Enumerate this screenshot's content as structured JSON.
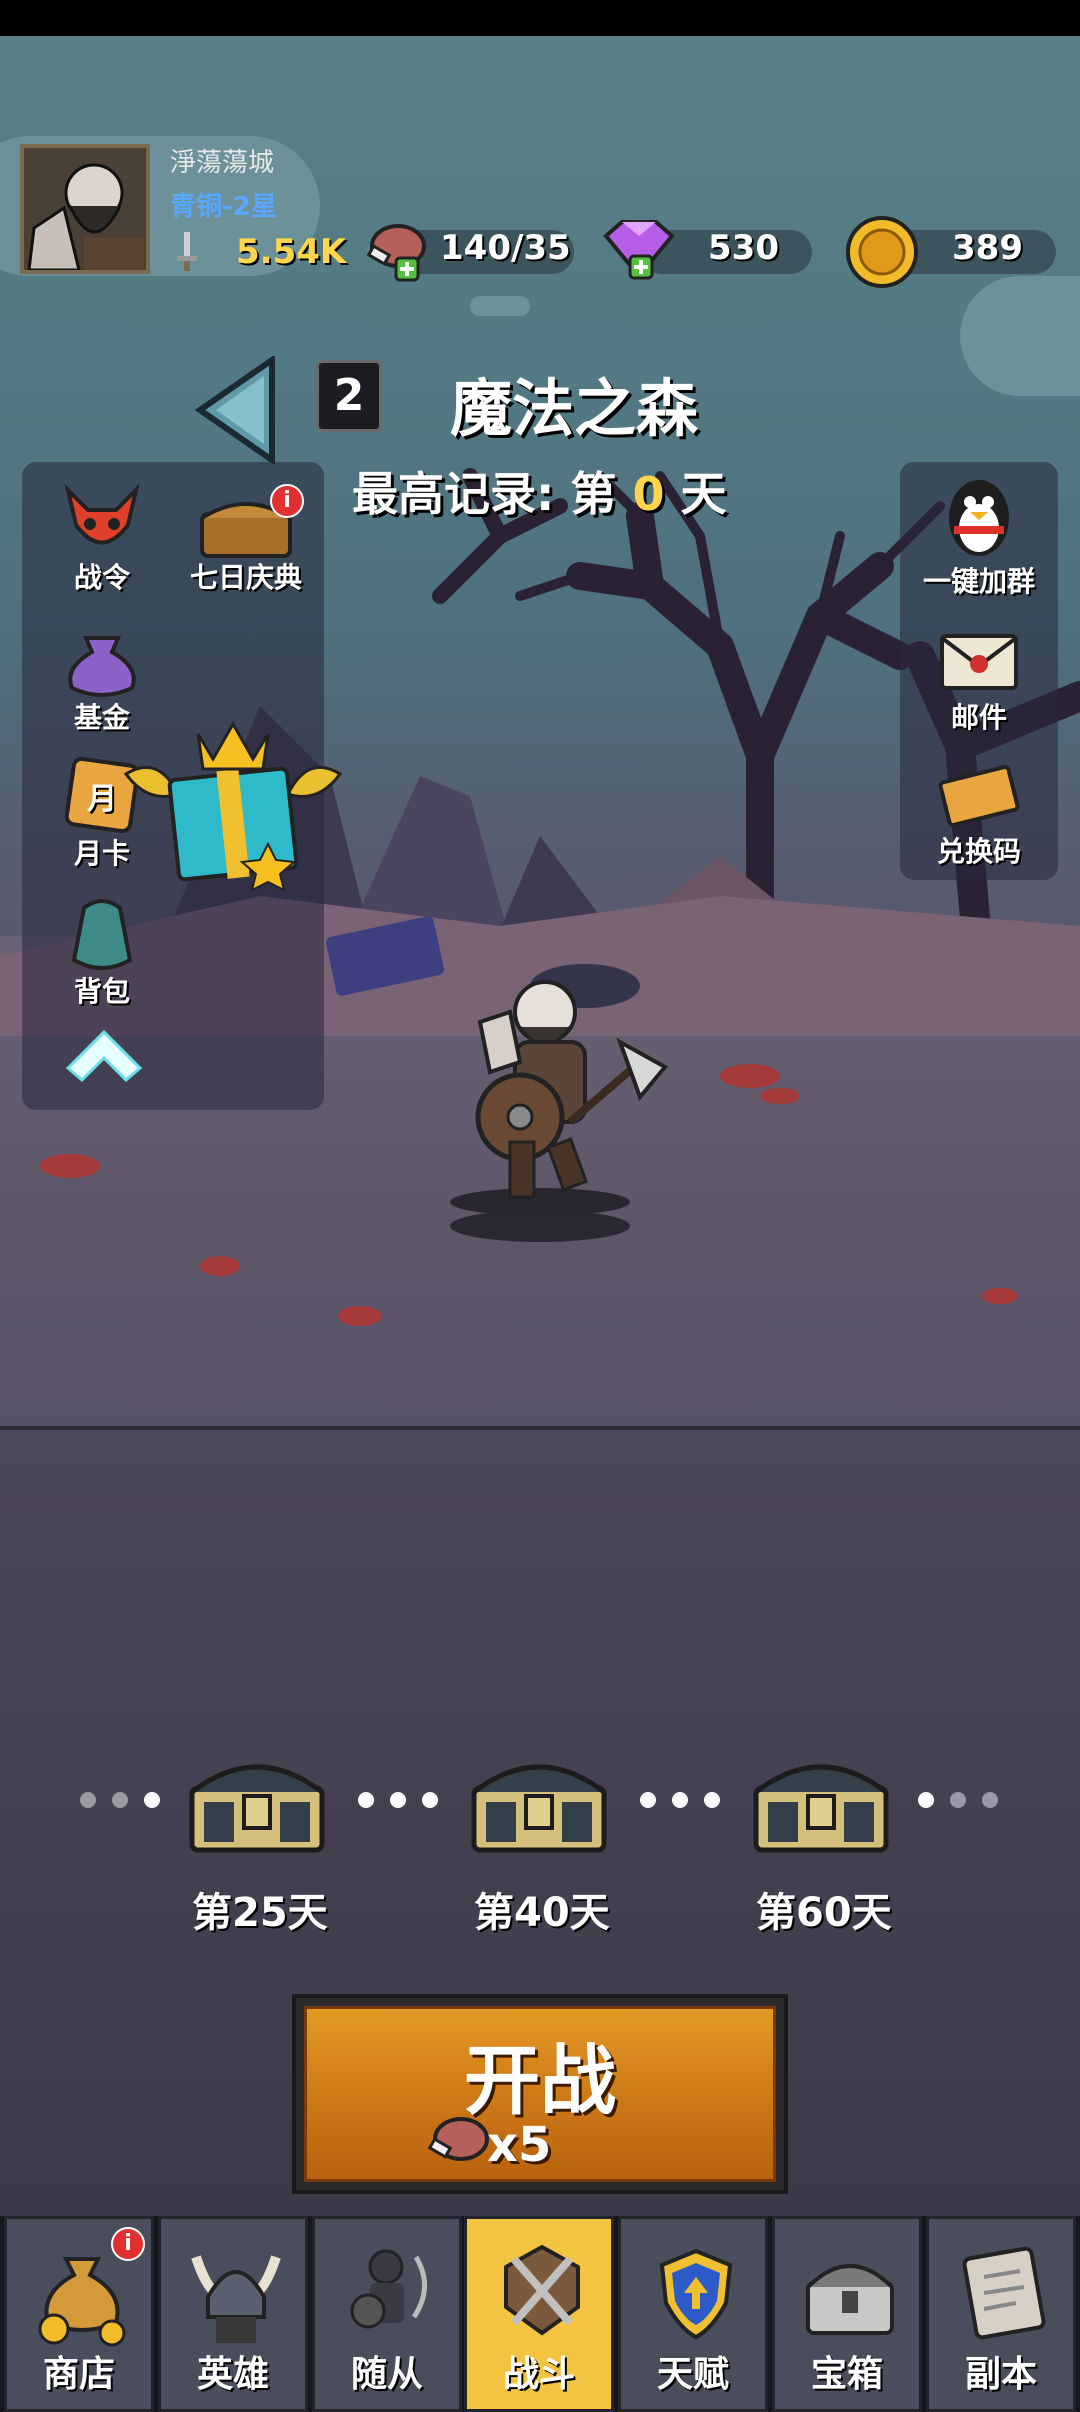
{
  "player": {
    "name": "淨蕩蕩城",
    "rank": "青铜-2星",
    "power": "5.54K"
  },
  "resources": {
    "stamina": "140/35",
    "gems": "530",
    "coins": "389"
  },
  "stage": {
    "number": "2",
    "title": "魔法之森",
    "record_prefix": "最高记录: 第 ",
    "record_day": "0",
    "record_suffix": " 天"
  },
  "left_menu": [
    {
      "label": "战令"
    },
    {
      "label": "七日庆典",
      "badge": "i"
    },
    {
      "label": "基金"
    },
    {
      "label": "月卡",
      "icon_text": "月"
    },
    {
      "label": "背包"
    }
  ],
  "right_menu": [
    {
      "label": "一键加群"
    },
    {
      "label": "邮件"
    },
    {
      "label": "兑换码"
    }
  ],
  "milestones": [
    {
      "label": "第25天"
    },
    {
      "label": "第40天"
    },
    {
      "label": "第60天"
    }
  ],
  "battle": {
    "label": "开战",
    "cost": "x5"
  },
  "nav": [
    {
      "label": "商店",
      "badge": "i",
      "icon": "money-bag-icon"
    },
    {
      "label": "英雄",
      "icon": "viking-helmet-icon"
    },
    {
      "label": "随从",
      "icon": "follower-icon"
    },
    {
      "label": "战斗",
      "icon": "crossed-swords-icon",
      "active": true
    },
    {
      "label": "天赋",
      "icon": "talent-shield-icon"
    },
    {
      "label": "宝箱",
      "icon": "chest-icon"
    },
    {
      "label": "副本",
      "icon": "scroll-map-icon"
    }
  ],
  "colors": {
    "accent_gold": "#ffd54a",
    "rank_blue": "#59a7ff",
    "active_tab": "#f3c43f",
    "battle_orange": "#cf7a18"
  }
}
